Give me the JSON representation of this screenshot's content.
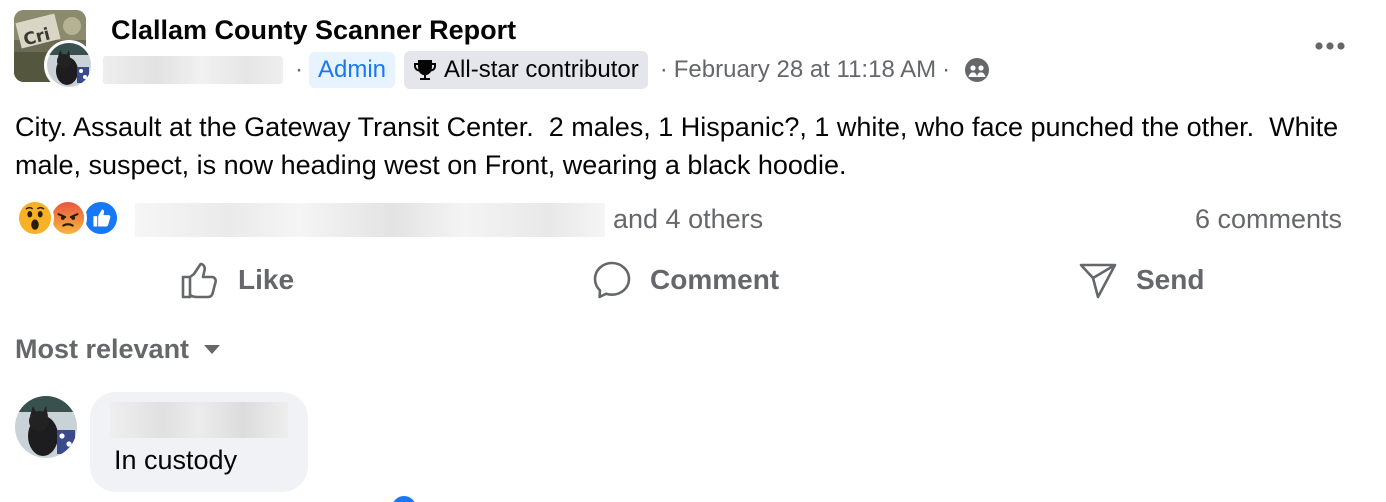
{
  "post": {
    "group_name": "Clallam County Scanner Report",
    "admin_label": "Admin",
    "contributor_label": "All-star contributor",
    "separator": "·",
    "date": "February 28 at 11:18 AM",
    "body": "City. Assault at the Gateway Transit Center.  2 males, 1 Hispanic?, 1 white, who face punched the other.  White male, suspect, is now heading west on Front, wearing a black hoodie.",
    "icons": {
      "group_avatar": "group-avatar-image",
      "author_avatar": "cat-avatar-image",
      "privacy": "group-members-icon",
      "more": "more-options-icon",
      "trophy": "trophy-icon"
    }
  },
  "reactions": {
    "types": [
      "wow",
      "angry",
      "like"
    ],
    "others_text": "and 4 others",
    "comments_text": "6 comments"
  },
  "actions": {
    "like": "Like",
    "comment": "Comment",
    "send": "Send"
  },
  "comments": {
    "sort_label": "Most relevant",
    "items": [
      {
        "text": "In custody"
      }
    ]
  },
  "colors": {
    "text_primary": "#050505",
    "text_secondary": "#65676b",
    "accent_blue": "#1877f2",
    "badge_blue_bg": "#e7f3ff",
    "badge_gray_bg": "#e4e6eb",
    "bubble_bg": "#f0f2f5"
  }
}
